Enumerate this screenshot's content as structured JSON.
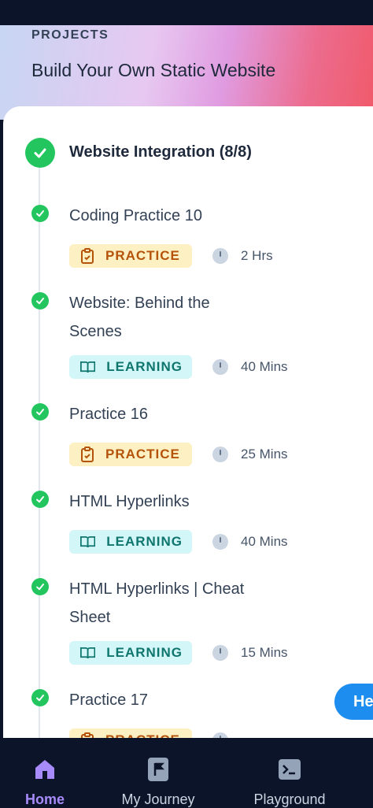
{
  "header": {
    "label": "PROJECTS",
    "title": "Build Your Own Static Website"
  },
  "module": {
    "title": "Website Integration (8/8)",
    "status": "completed"
  },
  "items": [
    {
      "title": "Coding Practice 10",
      "type": "PRACTICE",
      "duration": "2 Hrs",
      "completed": true
    },
    {
      "title": "Website: Behind the Scenes",
      "type": "LEARNING",
      "duration": "40 Mins",
      "completed": true
    },
    {
      "title": "Practice 16",
      "type": "PRACTICE",
      "duration": "25 Mins",
      "completed": true
    },
    {
      "title": "HTML Hyperlinks",
      "type": "LEARNING",
      "duration": "40 Mins",
      "completed": true
    },
    {
      "title": "HTML Hyperlinks | Cheat Sheet",
      "type": "LEARNING",
      "duration": "15 Mins",
      "completed": true
    },
    {
      "title": "Practice 17",
      "type": "PRACTICE",
      "duration": "",
      "completed": true
    }
  ],
  "help_button": {
    "label": "He"
  },
  "bottom_nav": {
    "items": [
      {
        "label": "Home",
        "icon": "home-icon",
        "active": true
      },
      {
        "label": "My Journey",
        "icon": "flag-icon",
        "active": false
      },
      {
        "label": "Playground",
        "icon": "terminal-icon",
        "active": false
      }
    ]
  },
  "colors": {
    "success": "#22c55e",
    "practice_bg": "#fdf0c3",
    "practice_text": "#b45309",
    "learning_bg": "#d3f6f8",
    "learning_text": "#0f766e",
    "nav_active": "#a78bfa",
    "help_button": "#1d8ef0"
  }
}
